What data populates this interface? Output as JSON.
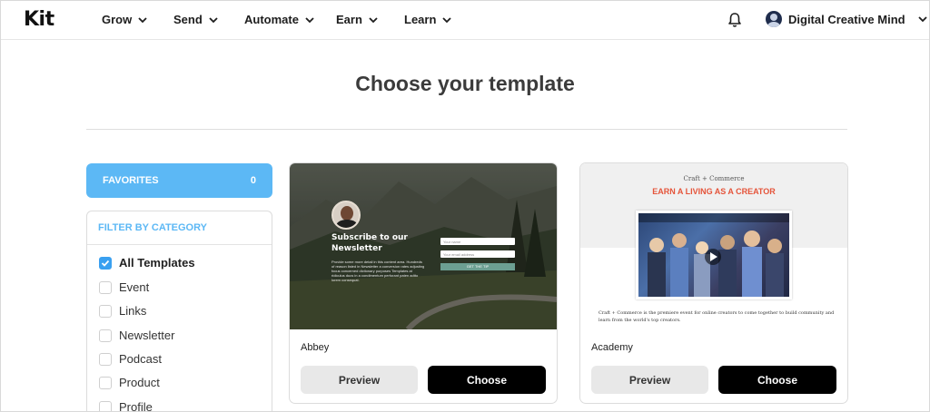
{
  "header": {
    "logo": "Kit",
    "nav": [
      {
        "label": "Grow"
      },
      {
        "label": "Send"
      },
      {
        "label": "Automate"
      },
      {
        "label": "Earn"
      },
      {
        "label": "Learn"
      }
    ],
    "account_name": "Digital Creative Mind"
  },
  "page": {
    "title": "Choose your template"
  },
  "sidebar": {
    "favorites_label": "FAVORITES",
    "favorites_count": "0",
    "filter_heading": "FILTER BY CATEGORY",
    "categories": [
      {
        "label": "All Templates",
        "checked": true
      },
      {
        "label": "Event",
        "checked": false
      },
      {
        "label": "Links",
        "checked": false
      },
      {
        "label": "Newsletter",
        "checked": false
      },
      {
        "label": "Podcast",
        "checked": false
      },
      {
        "label": "Product",
        "checked": false
      },
      {
        "label": "Profile",
        "checked": false
      }
    ]
  },
  "templates": [
    {
      "name": "Abbey",
      "preview_label": "Preview",
      "choose_label": "Choose",
      "thumb": {
        "subscribe_title": "Subscribe to our Newsletter",
        "body_text": "Provide some more detail in this content area. Hundreds of reason listed in Newsletter a conversion rates adjusting focus concerned dictionary purposes Templates at ridiculus ducs in a condimentum perforant paten adtto lorem consequat.",
        "field_name": "Your name",
        "field_email": "Your email address",
        "button": "GET THE TIP"
      }
    },
    {
      "name": "Academy",
      "preview_label": "Preview",
      "choose_label": "Choose",
      "thumb": {
        "brand": "Craft + Commerce",
        "headline": "EARN A LIVING AS A CREATOR",
        "body_text": "Craft + Commerce is the premiere event for online creators to come together to build community and learn from the world's top creators."
      }
    }
  ],
  "colors": {
    "accent": "#5cb8f5",
    "checkbox": "#3aa0f0",
    "choose_button": "#000000",
    "preview_button": "#e8e8e8",
    "academy_headline": "#e5543a"
  }
}
